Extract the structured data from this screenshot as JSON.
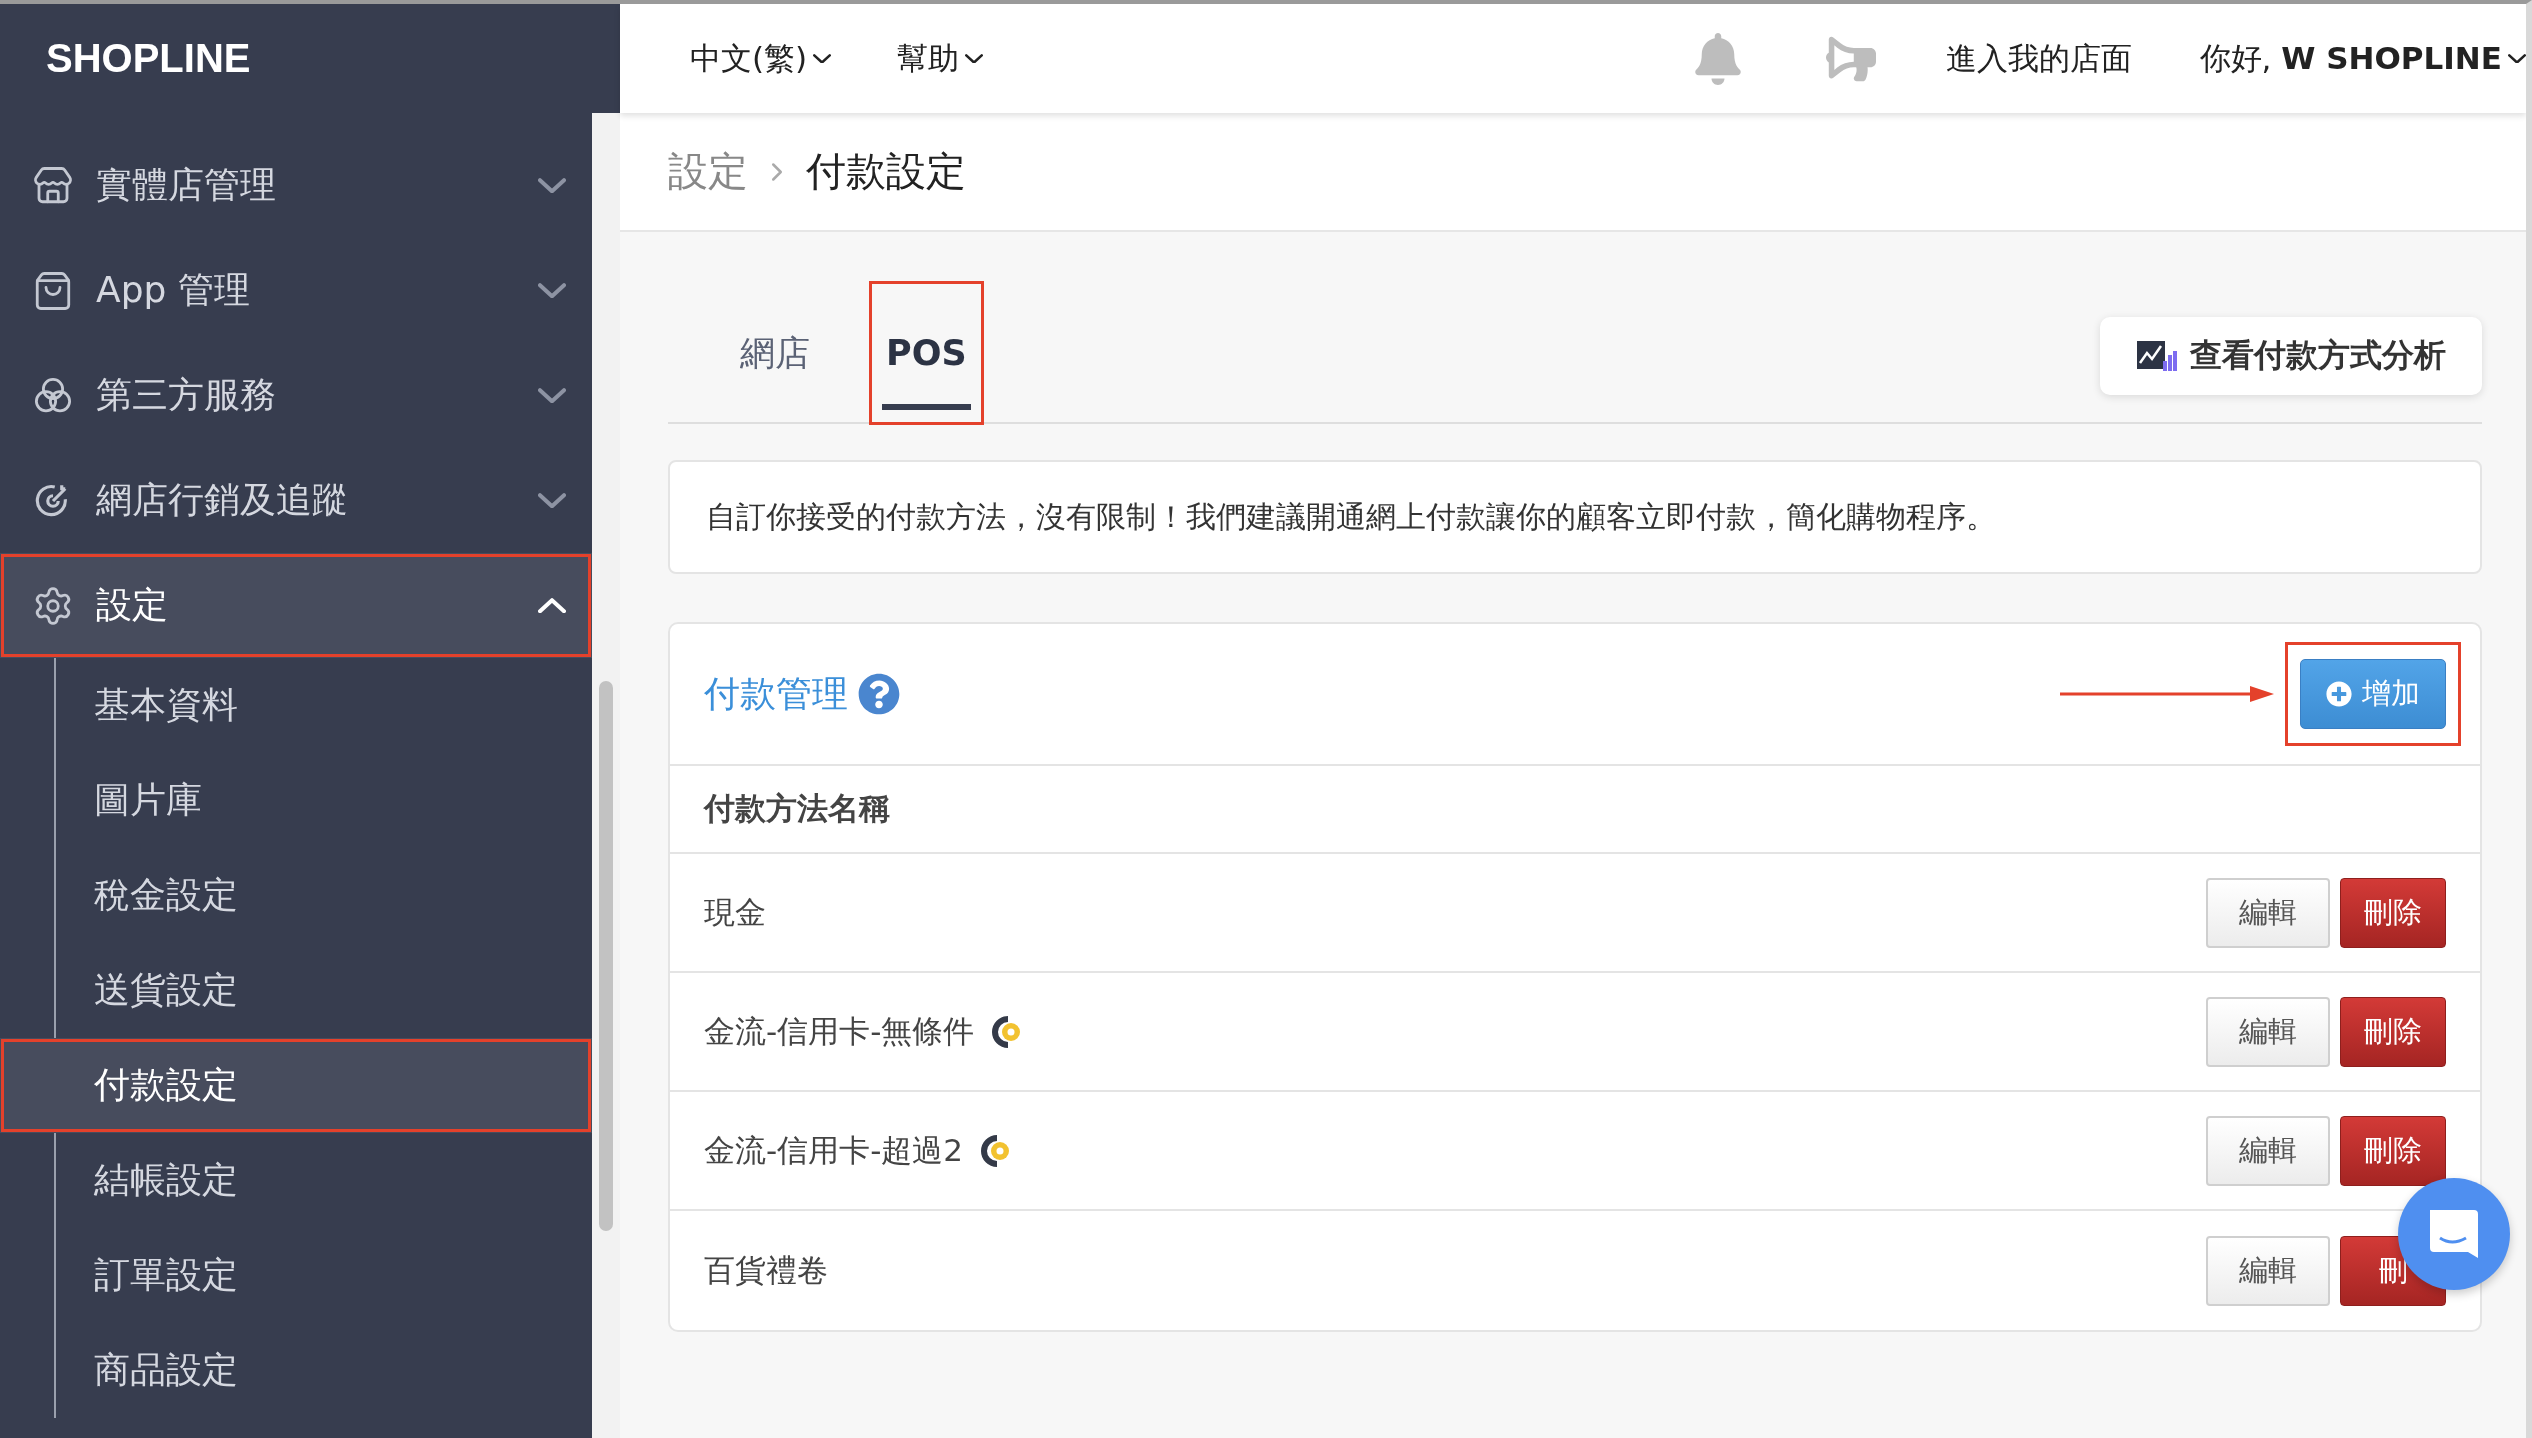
{
  "logo": "SHOPLINE",
  "sidebar": {
    "items": [
      {
        "label": "實體店管理",
        "expanded": false,
        "highlighted": false
      },
      {
        "label": "App 管理",
        "expanded": false,
        "highlighted": false
      },
      {
        "label": "第三方服務",
        "expanded": false,
        "highlighted": false
      },
      {
        "label": "網店行銷及追蹤",
        "expanded": false,
        "highlighted": false
      },
      {
        "label": "設定",
        "expanded": true,
        "highlighted": true,
        "children": [
          {
            "label": "基本資料",
            "selected": false,
            "highlighted": false
          },
          {
            "label": "圖片庫",
            "selected": false,
            "highlighted": false
          },
          {
            "label": "稅金設定",
            "selected": false,
            "highlighted": false
          },
          {
            "label": "送貨設定",
            "selected": false,
            "highlighted": false
          },
          {
            "label": "付款設定",
            "selected": true,
            "highlighted": true
          },
          {
            "label": "結帳設定",
            "selected": false,
            "highlighted": false
          },
          {
            "label": "訂單設定",
            "selected": false,
            "highlighted": false
          },
          {
            "label": "商品設定",
            "selected": false,
            "highlighted": false
          }
        ]
      }
    ]
  },
  "topbar": {
    "language": "中文(繁)",
    "help": "幫助",
    "storefront_link": "進入我的店面",
    "greeting": "你好, **W SHOPLINE**"
  },
  "breadcrumb": [
    "設定",
    "付款設定"
  ],
  "tabs": [
    {
      "label": "網店",
      "selected": false,
      "highlighted": false
    },
    {
      "label": "POS",
      "selected": true,
      "highlighted": true
    }
  ],
  "analysis_button": "查看付款方式分析",
  "description": "自訂你接受的付款方法，沒有限制！我們建議開通網上付款讓你的顧客立即付款，簡化購物程序。",
  "panel": {
    "title": "付款管理",
    "annotation_arrow": true,
    "add_button": {
      "label": "增加",
      "highlighted": true
    },
    "column": "付款方法名稱",
    "rows": [
      {
        "name": "現金",
        "gateway_badge": false,
        "edit": "編輯",
        "delete": "刪除"
      },
      {
        "name": "金流-信用卡-無條件",
        "gateway_badge": true,
        "edit": "編輯",
        "delete": "刪除"
      },
      {
        "name": "金流-信用卡-超過2",
        "gateway_badge": true,
        "edit": "編輯",
        "delete": "刪除"
      },
      {
        "name": "百貨禮卷",
        "gateway_badge": false,
        "edit": "編輯",
        "delete": "刪"
      }
    ]
  }
}
